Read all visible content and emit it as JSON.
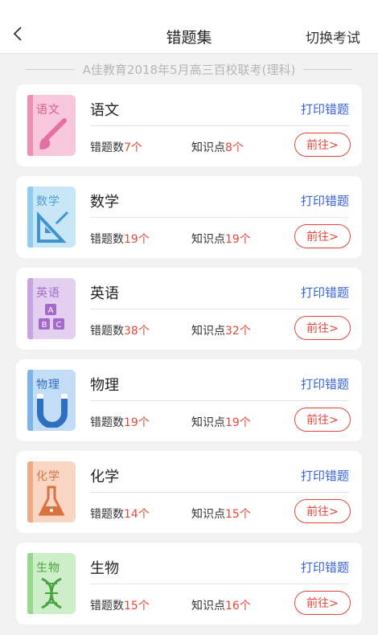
{
  "header": {
    "title": "错题集",
    "switch_label": "切换考试"
  },
  "exam": {
    "name": "A佳教育2018年5月高三百校联考(理科)"
  },
  "labels": {
    "print": "打印错题",
    "errors": "错题数",
    "points": "知识点",
    "unit": "个",
    "goto": "前往>"
  },
  "subjects": [
    {
      "name": "语文",
      "cover_label": "语文",
      "icon": "brush-icon",
      "errors": "7",
      "points": "8",
      "colors": {
        "bg": "#f7c8dc",
        "spine": "#ee8fb6",
        "text": "#d65a93",
        "art": "#e46fa3"
      }
    },
    {
      "name": "数学",
      "cover_label": "数学",
      "icon": "ruler-triangle-icon",
      "errors": "19",
      "points": "19",
      "colors": {
        "bg": "#c9e6f7",
        "spine": "#8ecbef",
        "text": "#4a9fd6",
        "art": "#3f93cf"
      }
    },
    {
      "name": "英语",
      "cover_label": "英语",
      "icon": "abc-blocks-icon",
      "errors": "38",
      "points": "32",
      "colors": {
        "bg": "#e3cff0",
        "spine": "#c8a4e3",
        "text": "#a46ac9",
        "art": "#a46ac9"
      }
    },
    {
      "name": "物理",
      "cover_label": "物理",
      "icon": "magnet-icon",
      "errors": "19",
      "points": "19",
      "colors": {
        "bg": "#c3ddf7",
        "spine": "#7fb4ea",
        "text": "#2f6fc0",
        "art": "#2f6fc0"
      }
    },
    {
      "name": "化学",
      "cover_label": "化学",
      "icon": "flask-icon",
      "errors": "14",
      "points": "15",
      "colors": {
        "bg": "#f9d6c4",
        "spine": "#f0ab86",
        "text": "#d8733f",
        "art": "#d8733f"
      }
    },
    {
      "name": "生物",
      "cover_label": "生物",
      "icon": "dna-icon",
      "errors": "15",
      "points": "16",
      "colors": {
        "bg": "#cdeec9",
        "spine": "#97d78e",
        "text": "#4aa442",
        "art": "#4aa442"
      }
    }
  ]
}
